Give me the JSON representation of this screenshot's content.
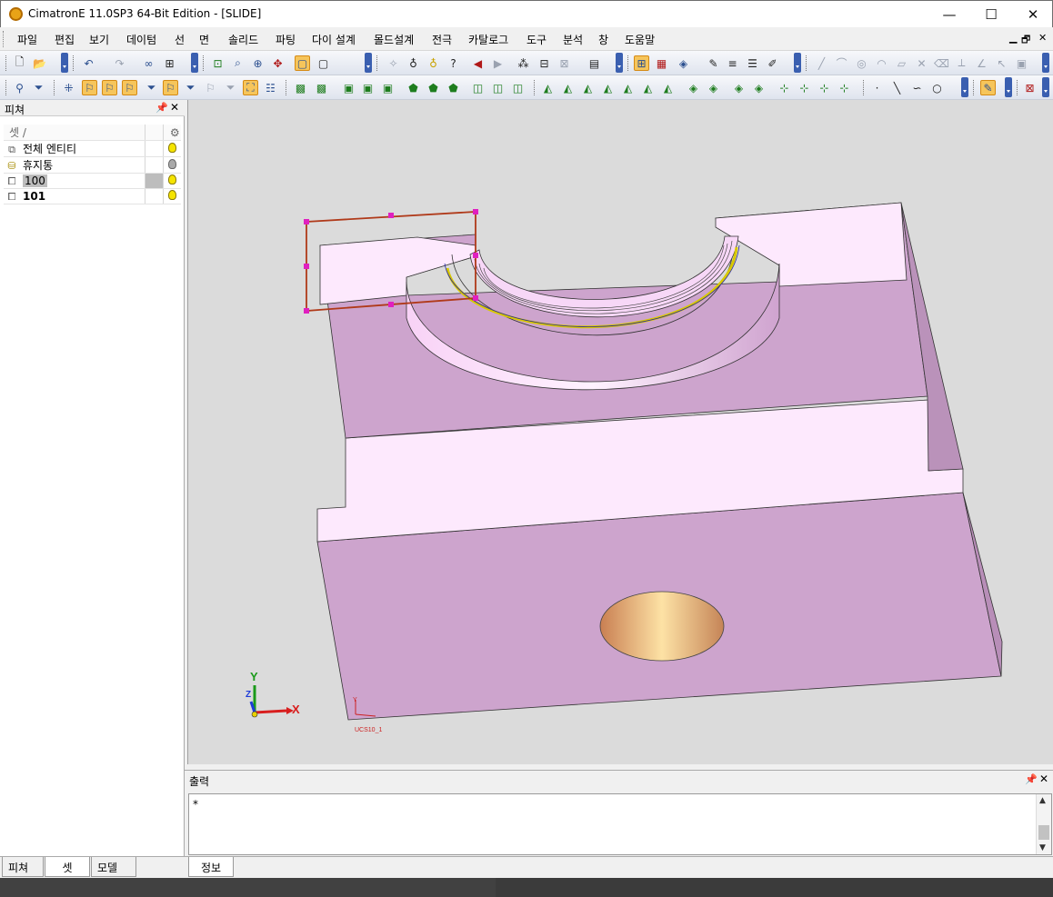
{
  "window": {
    "title": "CimatronE 11.0SP3 64-Bit Edition - [SLIDE]",
    "minimize": "—",
    "maximize": "☐",
    "close": "✕"
  },
  "menu": {
    "items": [
      "파일",
      "편집",
      "보기",
      "데이텀",
      "선",
      "면",
      "솔리드",
      "파팅",
      "다이 설계",
      "몰드설계",
      "전극",
      "카탈로그",
      "도구",
      "분석",
      "창",
      "도움말"
    ],
    "mdi_min": "▁",
    "mdi_restore": "🗗",
    "mdi_close": "✕"
  },
  "left_panel": {
    "title": "피쳐",
    "pin": "📌",
    "close": "✕",
    "column_header": "셋 /",
    "rows": [
      {
        "name": "전체 엔티티",
        "icon": "layers-icon",
        "bulb": "on"
      },
      {
        "name": "휴지통",
        "icon": "trash-bin-icon",
        "bulb": "off"
      },
      {
        "name": "100",
        "icon": "set-icon",
        "bulb": "on"
      },
      {
        "name": "101",
        "icon": "set-icon",
        "bulb": "on"
      }
    ],
    "tabs": [
      "피쳐",
      "셋",
      "모델 뷰"
    ]
  },
  "viewport": {
    "axis_x": "X",
    "axis_y": "Y",
    "axis_z": "Z",
    "ucs_label": "UCS10_1",
    "ucs_y": "Y"
  },
  "output": {
    "title": "출력",
    "pin": "📌",
    "close": "✕",
    "line": "*",
    "tab": "정보"
  },
  "colors": {
    "part_face_top": "#cda4cd",
    "part_face_light": "#fde9fd",
    "viewport_bg": "#dbdbdb",
    "selection_box": "#b03a1a",
    "handle": "#e020c0"
  }
}
